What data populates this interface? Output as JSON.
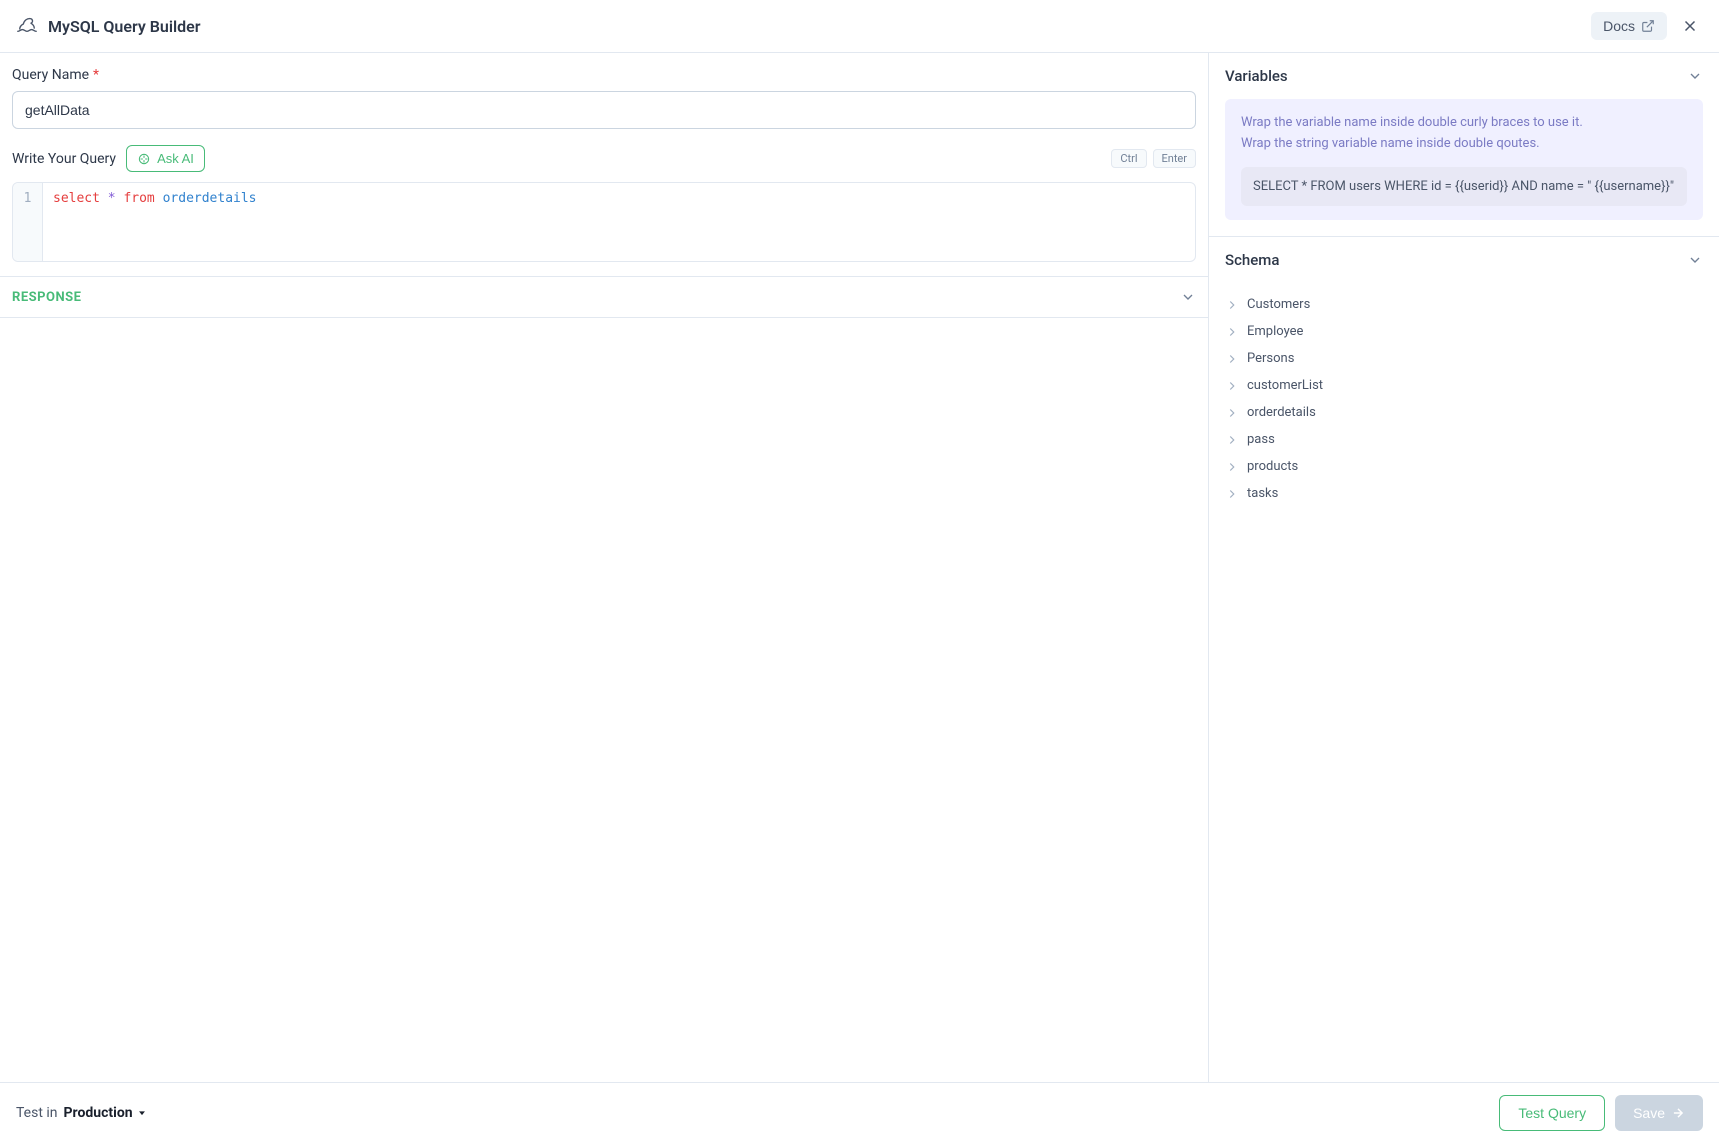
{
  "header": {
    "title": "MySQL Query Builder",
    "docs_label": "Docs"
  },
  "form": {
    "query_name_label": "Query Name",
    "query_name_value": "getAllData",
    "write_query_label": "Write Your Query",
    "ask_ai_label": "Ask AI",
    "shortcut_ctrl": "Ctrl",
    "shortcut_enter": "Enter",
    "code": {
      "line_number": "1",
      "token_select": "select",
      "token_star": "*",
      "token_from": "from",
      "token_table": "orderdetails"
    }
  },
  "response": {
    "title": "RESPONSE"
  },
  "sidebar": {
    "variables": {
      "title": "Variables",
      "hint1": "Wrap the variable name inside double curly braces to use it.",
      "hint2": "Wrap the string variable name inside double qoutes.",
      "example": "SELECT * FROM users WHERE id = {{userid}} AND name = \" {{username}}\""
    },
    "schema": {
      "title": "Schema",
      "items": [
        "Customers",
        "Employee",
        "Persons",
        "customerList",
        "orderdetails",
        "pass",
        "products",
        "tasks"
      ]
    }
  },
  "footer": {
    "test_in_label": "Test in",
    "environment": "Production",
    "test_query_label": "Test Query",
    "save_label": "Save"
  }
}
